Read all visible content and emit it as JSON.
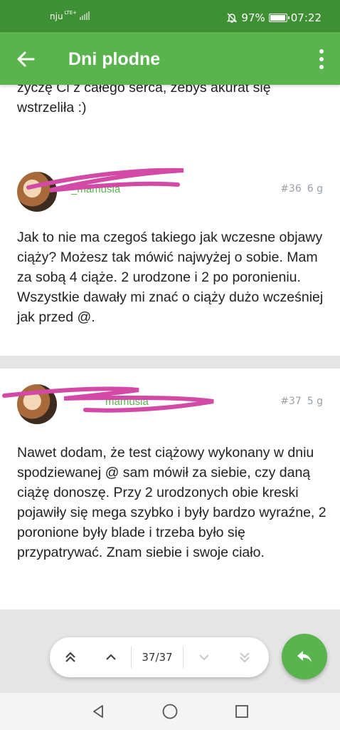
{
  "status_bar": {
    "carrier": "nju",
    "network": "LTE+",
    "battery": "97%",
    "battery_level": 0.97,
    "time": "07:22"
  },
  "app_bar": {
    "title": "Dni plodne",
    "back_icon": "arrow-left-icon",
    "menu_icon": "more-vertical-icon"
  },
  "posts": [
    {
      "text": "życzę Ci z całego serca, żebyś akurat się wstrzeliła :)"
    },
    {
      "username": "_mamusia",
      "number": "#36",
      "age": "6 g",
      "text": "Jak to nie ma czegoś takiego jak wczesne objawy ciąży? Możesz tak mówić najwyżej o sobie. Mam za sobą 4 ciąże. 2 urodzone i 2 po poronieniu. Wszystkie dawały mi znać o ciąży dużo wcześniej jak przed @."
    },
    {
      "username": "mamusia",
      "number": "#37",
      "age": "5 g",
      "text": "Nawet dodam, że test ciążowy wykonany w dniu spodziewanej @ sam mówił za siebie, czy daną ciążę donoszę. Przy 2 urodzonych obie kreski pojawiły się mega szybko i były bardzo wyraźne, 2 poronione były blade i trzeba było się przypatrywać. Znam siebie i swoje ciało."
    }
  ],
  "pager": {
    "label": "37/37",
    "icons": [
      "double-chevron-up-icon",
      "chevron-up-icon",
      "chevron-down-icon",
      "double-chevron-down-icon"
    ]
  },
  "fab": {
    "icon": "reply-icon"
  },
  "nav_bar": {
    "icons": [
      "back-triangle-icon",
      "home-circle-icon",
      "recents-square-icon"
    ]
  },
  "colors": {
    "status_bar": "#3f8f35",
    "app_bar": "#5ab44e",
    "accent": "#5ab44e",
    "redaction": "#d34aa6"
  }
}
